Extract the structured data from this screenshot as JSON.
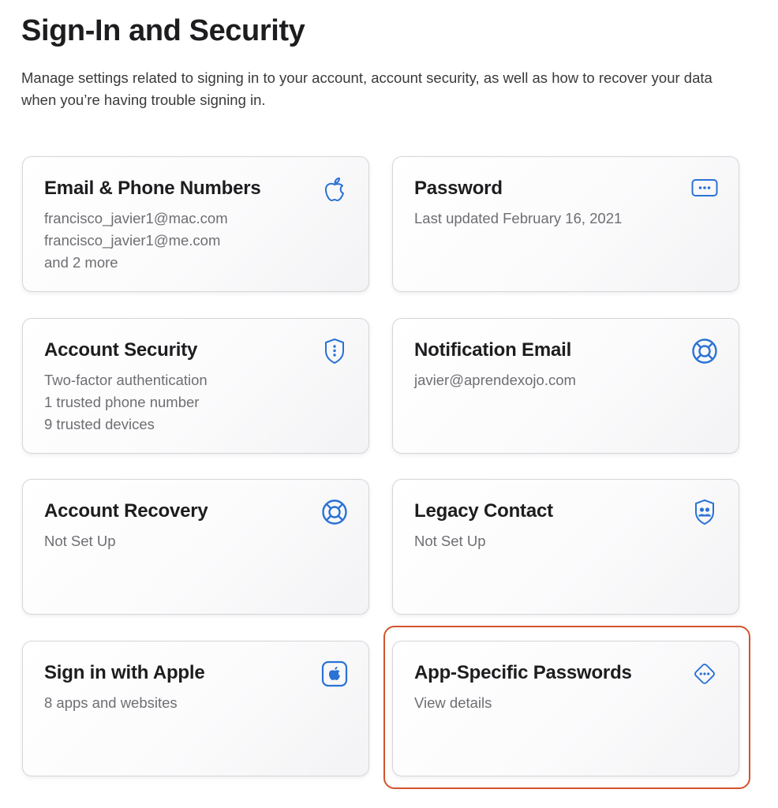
{
  "page": {
    "title": "Sign-In and Security",
    "description": "Manage settings related to signing in to your account, account security, as well as how to recover your data when you’re having trouble signing in."
  },
  "colors": {
    "accent": "#2a72d5",
    "highlight": "#d2542b"
  },
  "cards": [
    {
      "title": "Email & Phone Numbers",
      "icon": "apple-logo-icon",
      "lines": [
        "francisco_javier1@mac.com",
        "francisco_javier1@me.com",
        "and 2 more"
      ]
    },
    {
      "title": "Password",
      "icon": "password-dots-icon",
      "lines": [
        "Last updated February 16, 2021"
      ]
    },
    {
      "title": "Account Security",
      "icon": "shield-icon",
      "lines": [
        "Two-factor authentication",
        "1 trusted phone number",
        "9 trusted devices"
      ]
    },
    {
      "title": "Notification Email",
      "icon": "lifebuoy-icon",
      "lines": [
        "javier@aprendexojo.com"
      ]
    },
    {
      "title": "Account Recovery",
      "icon": "lifebuoy-icon",
      "lines": [
        "Not Set Up"
      ]
    },
    {
      "title": "Legacy Contact",
      "icon": "legacy-contact-shield-icon",
      "lines": [
        "Not Set Up"
      ]
    },
    {
      "title": "Sign in with Apple",
      "icon": "sign-in-with-apple-icon",
      "lines": [
        "8 apps and websites"
      ]
    },
    {
      "title": "App-Specific Passwords",
      "icon": "diamond-dots-icon",
      "lines": [
        "View details"
      ],
      "highlighted": true
    }
  ]
}
